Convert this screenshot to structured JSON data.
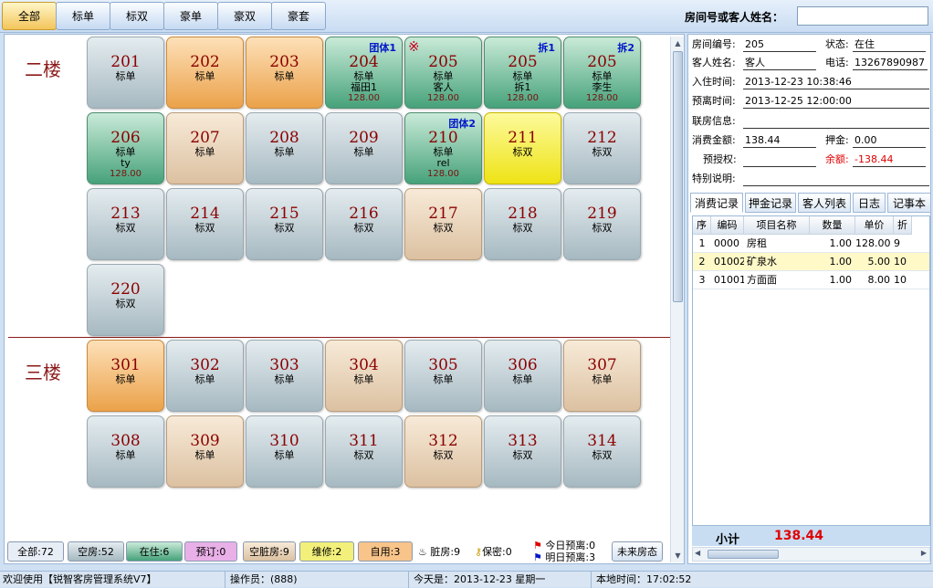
{
  "tabs": [
    "全部",
    "标单",
    "标双",
    "豪单",
    "豪双",
    "豪套"
  ],
  "search": {
    "label": "房间号或客人姓名：",
    "value": ""
  },
  "floors": [
    {
      "name": "二楼",
      "rooms": [
        {
          "num": "201",
          "type": "标单",
          "status": "vacant"
        },
        {
          "num": "202",
          "type": "标单",
          "status": "reserved"
        },
        {
          "num": "203",
          "type": "标单",
          "status": "reserved"
        },
        {
          "num": "204",
          "type": "标单",
          "status": "occupied",
          "guest": "福田1",
          "price": "128.00",
          "badge": "团体1"
        },
        {
          "num": "205",
          "type": "标单",
          "status": "occupied",
          "guest": "客人",
          "price": "128.00",
          "mark": "※"
        },
        {
          "num": "205",
          "type": "标单",
          "status": "occupied",
          "guest": "拆1",
          "price": "128.00",
          "badge": "拆1"
        },
        {
          "num": "205",
          "type": "标单",
          "status": "occupied",
          "guest": "李生",
          "price": "128.00",
          "badge": "拆2"
        },
        {
          "num": "206",
          "type": "标单",
          "status": "occupied",
          "guest": "ty",
          "price": "128.00"
        },
        {
          "num": "207",
          "type": "标单",
          "status": "dirty"
        },
        {
          "num": "208",
          "type": "标单",
          "status": "vacant"
        },
        {
          "num": "209",
          "type": "标单",
          "status": "vacant"
        },
        {
          "num": "210",
          "type": "标单",
          "status": "occupied",
          "guest": "rel",
          "price": "128.00",
          "badge": "团体2"
        },
        {
          "num": "211",
          "type": "标双",
          "status": "selected"
        },
        {
          "num": "212",
          "type": "标双",
          "status": "vacant"
        },
        {
          "num": "213",
          "type": "标双",
          "status": "vacant"
        },
        {
          "num": "214",
          "type": "标双",
          "status": "vacant"
        },
        {
          "num": "215",
          "type": "标双",
          "status": "vacant"
        },
        {
          "num": "216",
          "type": "标双",
          "status": "vacant"
        },
        {
          "num": "217",
          "type": "标双",
          "status": "dirty"
        },
        {
          "num": "218",
          "type": "标双",
          "status": "vacant"
        },
        {
          "num": "219",
          "type": "标双",
          "status": "vacant"
        },
        {
          "num": "220",
          "type": "标双",
          "status": "vacant"
        }
      ]
    },
    {
      "name": "三楼",
      "rooms": [
        {
          "num": "301",
          "type": "标单",
          "status": "reserved"
        },
        {
          "num": "302",
          "type": "标单",
          "status": "vacant"
        },
        {
          "num": "303",
          "type": "标单",
          "status": "vacant"
        },
        {
          "num": "304",
          "type": "标单",
          "status": "dirty"
        },
        {
          "num": "305",
          "type": "标单",
          "status": "vacant"
        },
        {
          "num": "306",
          "type": "标单",
          "status": "vacant"
        },
        {
          "num": "307",
          "type": "标单",
          "status": "dirty"
        },
        {
          "num": "308",
          "type": "标单",
          "status": "vacant"
        },
        {
          "num": "309",
          "type": "标单",
          "status": "dirty"
        },
        {
          "num": "310",
          "type": "标单",
          "status": "vacant"
        },
        {
          "num": "311",
          "type": "标双",
          "status": "vacant"
        },
        {
          "num": "312",
          "type": "标双",
          "status": "dirty"
        },
        {
          "num": "313",
          "type": "标双",
          "status": "vacant"
        },
        {
          "num": "314",
          "type": "标双",
          "status": "vacant"
        }
      ]
    }
  ],
  "legend": {
    "all": "全部:72",
    "vacant": "空房:52",
    "occupied": "在住:6",
    "reserved": "预订:0",
    "dirty_vacant": "空脏房:9",
    "repair": "维修:2",
    "self_use": "自用:3",
    "dirty": "脏房:9",
    "secret": "保密:0",
    "today_leave": "今日预离:0",
    "tomorrow_leave": "明日预离:3",
    "future": "未来房态"
  },
  "colors": {
    "vacant": "#a6b9c1",
    "occupied": "#46a27a",
    "reserved": "#eba24a",
    "dirty": "#dcc1a1",
    "selected": "#eee315",
    "repair": "#f2f07a",
    "self_use": "#f8c48a",
    "reserved_legend": "#e9b0e8"
  },
  "info": {
    "room_no_label": "房间编号:",
    "room_no": "205",
    "status_label": "状态:",
    "status": "在住",
    "guest_label": "客人姓名:",
    "guest": "客人",
    "phone_label": "电话:",
    "phone": "13267890987",
    "checkin_label": "入住时间:",
    "checkin": "2013-12-23 10:38:46",
    "leave_label": "预离时间:",
    "leave": "2013-12-25 12:00:00",
    "linked_label": "联房信息:",
    "linked": "",
    "consume_label": "消费金额:",
    "consume": "138.44",
    "deposit_label": "押金:",
    "deposit": "0.00",
    "preauth_label": "预授权:",
    "preauth": "",
    "balance_label": "余额:",
    "balance": "-138.44",
    "special_label": "特别说明:",
    "special": ""
  },
  "right_tabs": [
    "消费记录",
    "押金记录",
    "客人列表",
    "日志",
    "记事本"
  ],
  "table": {
    "headers": [
      "序",
      "编码",
      "项目名称",
      "数量",
      "单价",
      "折"
    ],
    "rows": [
      [
        "1",
        "0000",
        "房租",
        "1.00",
        "128.00",
        "9"
      ],
      [
        "2",
        "01002",
        "矿泉水",
        "1.00",
        "5.00",
        "10"
      ],
      [
        "3",
        "01001",
        "方面面",
        "1.00",
        "8.00",
        "10"
      ]
    ]
  },
  "subtotal": {
    "label": "小计",
    "value": "138.44"
  },
  "statusbar": {
    "welcome": "欢迎使用【锐智客房管理系统V7】",
    "operator": "操作员：(888)",
    "today": "今天是：2013-12-23 星期一",
    "time": "本地时间：17:02:52"
  }
}
